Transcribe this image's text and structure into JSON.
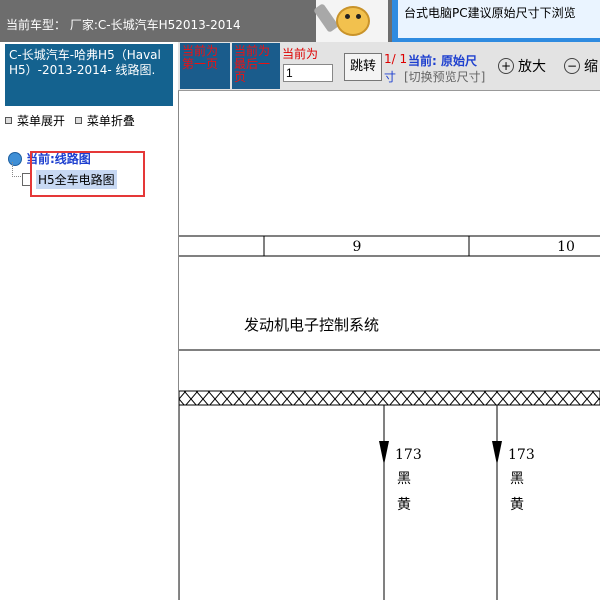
{
  "header": {
    "car_model": "当前车型： 厂家:C-长城汽车H52013-2014",
    "banner_text": "台式电脑PC建议原始尺寸下浏览"
  },
  "sidebar": {
    "title": "C-长城汽车-哈弗H5（Haval H5）-2013-2014- 线路图.",
    "expand_label": "菜单展开",
    "collapse_label": "菜单折叠",
    "tree_root": "当前:线路图",
    "tree_leaf": "H5全车电路图"
  },
  "toolbar": {
    "first_page": "当前为第一页",
    "last_page": "当前为最后一页",
    "current_label": "当前为",
    "page_input": "1",
    "jump_label": "跳转",
    "page_count_top": "1/ 1",
    "page_count_bottom": "寸",
    "size_current": "当前: 原始尺",
    "size_switch": "[切换预览尺寸]",
    "zoom_in": "放大",
    "zoom_out": "缩"
  },
  "diagram": {
    "col_9": "9",
    "col_10": "10",
    "section_title": "发动机电子控制系统",
    "wire1_num": "173",
    "wire1_c1": "黑",
    "wire1_c2": "黄",
    "wire2_num": "173",
    "wire2_c1": "黑",
    "wire2_c2": "黄"
  },
  "colors": {
    "header_bg": "#6d6d6d",
    "sidebar_title_bg": "#14628f",
    "highlight": "#e53838",
    "tree_text": "#1d3fcf"
  }
}
